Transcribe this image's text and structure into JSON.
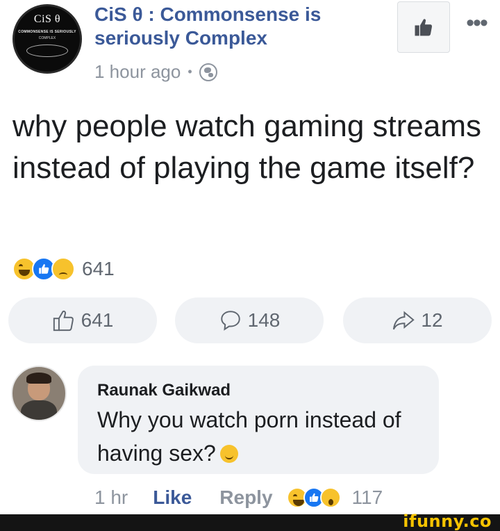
{
  "page": {
    "logo_text": "CiS θ",
    "logo_line": "COMMONSENSE IS SERIOUSLY",
    "logo_sub": "COMPLEX",
    "name": "CiS θ : Commonsense is seriously Complex"
  },
  "post": {
    "time": "1 hour ago",
    "text": "why people watch gaming streams instead of playing the game itself?",
    "reactions": [
      "haha",
      "like",
      "sad"
    ],
    "reaction_count": "641",
    "like_count": "641",
    "comment_count": "148",
    "share_count": "12"
  },
  "comment": {
    "author": "Raunak Gaikwad",
    "text": "Why you watch porn instead of having sex?",
    "time": "1 hr",
    "like_label": "Like",
    "reply_label": "Reply",
    "reactions": [
      "haha",
      "like",
      "wow"
    ],
    "reaction_count": "117"
  },
  "watermark": "ifunny.co",
  "colors": {
    "link_blue": "#3b5998",
    "meta_gray": "#8d949e",
    "pill_bg": "#f0f2f5",
    "watermark_yellow": "#f6c300"
  }
}
